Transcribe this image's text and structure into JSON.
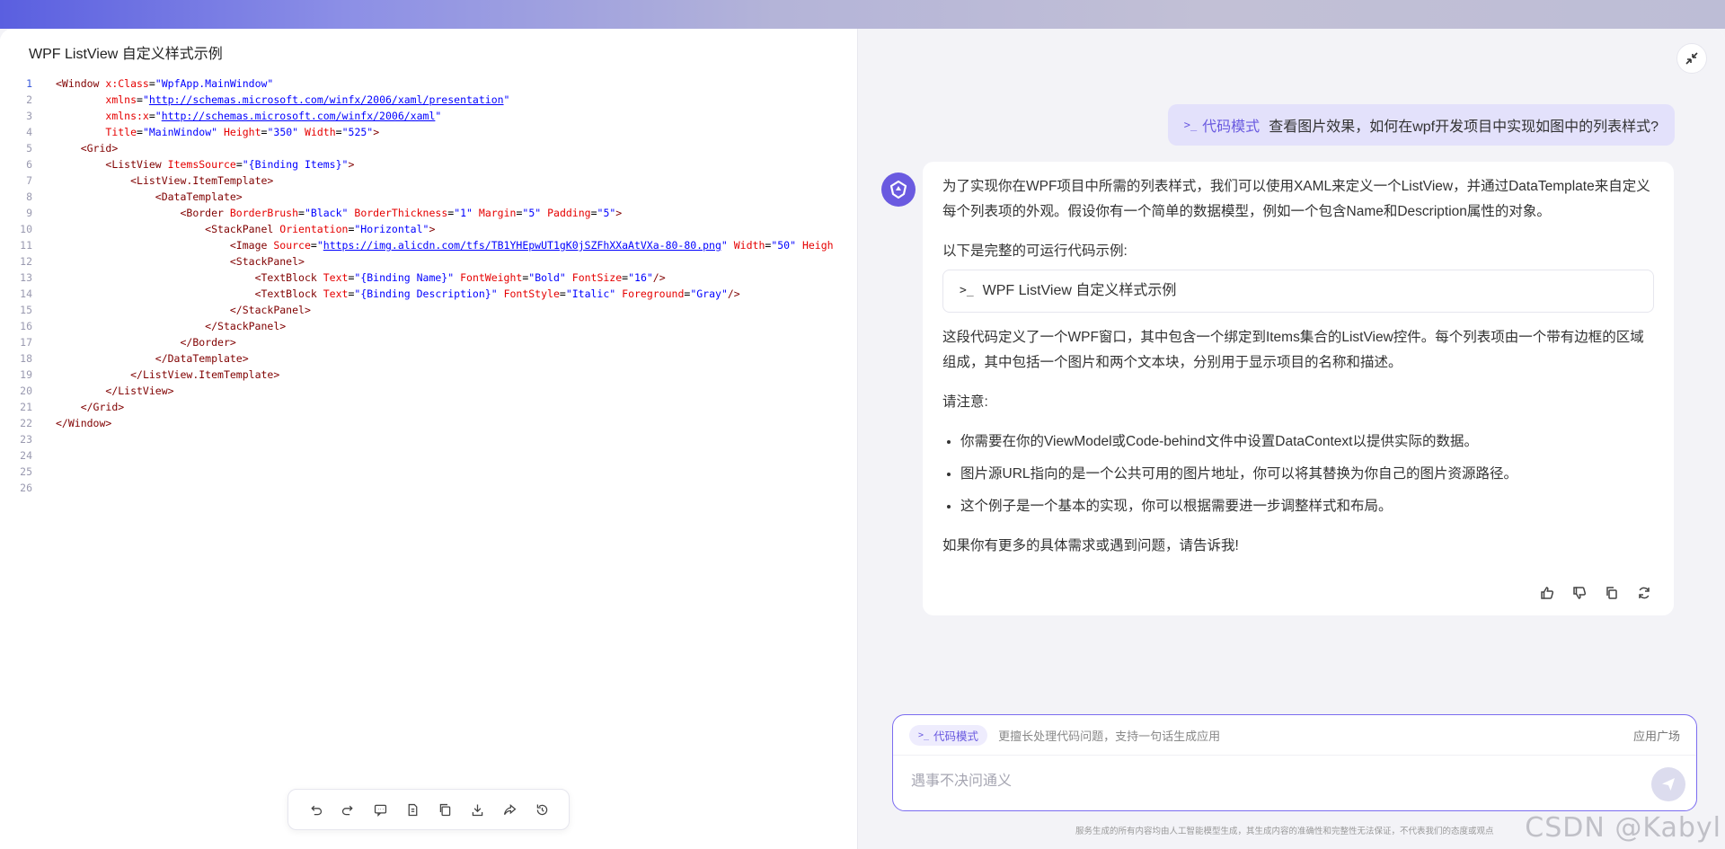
{
  "left": {
    "title": "WPF ListView 自定义样式示例",
    "line_numbers": [
      "1",
      "2",
      "3",
      "4",
      "5",
      "6",
      "7",
      "8",
      "9",
      "10",
      "11",
      "12",
      "13",
      "14",
      "15",
      "16",
      "17",
      "18",
      "19",
      "20",
      "21",
      "22",
      "23",
      "24",
      "25",
      "26"
    ],
    "code_lines": [
      [
        [
          "tag",
          "<Window "
        ],
        [
          "attr",
          "x:Class"
        ],
        [
          "plain",
          "="
        ],
        [
          "val",
          "\"WpfApp.MainWindow\""
        ]
      ],
      [
        [
          "plain",
          "        "
        ],
        [
          "attr",
          "xmlns"
        ],
        [
          "plain",
          "="
        ],
        [
          "val",
          "\""
        ],
        [
          "url",
          "http://schemas.microsoft.com/winfx/2006/xaml/presentation"
        ],
        [
          "val",
          "\""
        ]
      ],
      [
        [
          "plain",
          "        "
        ],
        [
          "attr",
          "xmlns:x"
        ],
        [
          "plain",
          "="
        ],
        [
          "val",
          "\""
        ],
        [
          "url",
          "http://schemas.microsoft.com/winfx/2006/xaml"
        ],
        [
          "val",
          "\""
        ]
      ],
      [
        [
          "plain",
          "        "
        ],
        [
          "attr",
          "Title"
        ],
        [
          "plain",
          "="
        ],
        [
          "val",
          "\"MainWindow\""
        ],
        [
          "plain",
          " "
        ],
        [
          "attr",
          "Height"
        ],
        [
          "plain",
          "="
        ],
        [
          "val",
          "\"350\""
        ],
        [
          "plain",
          " "
        ],
        [
          "attr",
          "Width"
        ],
        [
          "plain",
          "="
        ],
        [
          "val",
          "\"525\""
        ],
        [
          "tag",
          ">"
        ]
      ],
      [
        [
          "plain",
          "    "
        ],
        [
          "tag",
          "<Grid>"
        ]
      ],
      [
        [
          "plain",
          "        "
        ],
        [
          "tag",
          "<ListView "
        ],
        [
          "attr",
          "ItemsSource"
        ],
        [
          "plain",
          "="
        ],
        [
          "val",
          "\"{Binding Items}\""
        ],
        [
          "tag",
          ">"
        ]
      ],
      [
        [
          "plain",
          "            "
        ],
        [
          "tag",
          "<ListView.ItemTemplate>"
        ]
      ],
      [
        [
          "plain",
          "                "
        ],
        [
          "tag",
          "<DataTemplate>"
        ]
      ],
      [
        [
          "plain",
          "                    "
        ],
        [
          "tag",
          "<Border "
        ],
        [
          "attr",
          "BorderBrush"
        ],
        [
          "plain",
          "="
        ],
        [
          "val",
          "\"Black\""
        ],
        [
          "plain",
          " "
        ],
        [
          "attr",
          "BorderThickness"
        ],
        [
          "plain",
          "="
        ],
        [
          "val",
          "\"1\""
        ],
        [
          "plain",
          " "
        ],
        [
          "attr",
          "Margin"
        ],
        [
          "plain",
          "="
        ],
        [
          "val",
          "\"5\""
        ],
        [
          "plain",
          " "
        ],
        [
          "attr",
          "Padding"
        ],
        [
          "plain",
          "="
        ],
        [
          "val",
          "\"5\""
        ],
        [
          "tag",
          ">"
        ]
      ],
      [
        [
          "plain",
          "                        "
        ],
        [
          "tag",
          "<StackPanel "
        ],
        [
          "attr",
          "Orientation"
        ],
        [
          "plain",
          "="
        ],
        [
          "val",
          "\"Horizontal\""
        ],
        [
          "tag",
          ">"
        ]
      ],
      [
        [
          "plain",
          "                            "
        ],
        [
          "tag",
          "<Image "
        ],
        [
          "attr",
          "Source"
        ],
        [
          "plain",
          "="
        ],
        [
          "val",
          "\""
        ],
        [
          "url",
          "https://img.alicdn.com/tfs/TB1YHEpwUT1gK0jSZFhXXaAtVXa-80-80.png"
        ],
        [
          "val",
          "\""
        ],
        [
          "plain",
          " "
        ],
        [
          "attr",
          "Width"
        ],
        [
          "plain",
          "="
        ],
        [
          "val",
          "\"50\""
        ],
        [
          "plain",
          " "
        ],
        [
          "attr",
          "Heigh"
        ]
      ],
      [
        [
          "plain",
          "                            "
        ],
        [
          "tag",
          "<StackPanel>"
        ]
      ],
      [
        [
          "plain",
          "                                "
        ],
        [
          "tag",
          "<TextBlock "
        ],
        [
          "attr",
          "Text"
        ],
        [
          "plain",
          "="
        ],
        [
          "val",
          "\"{Binding Name}\""
        ],
        [
          "plain",
          " "
        ],
        [
          "attr",
          "FontWeight"
        ],
        [
          "plain",
          "="
        ],
        [
          "val",
          "\"Bold\""
        ],
        [
          "plain",
          " "
        ],
        [
          "attr",
          "FontSize"
        ],
        [
          "plain",
          "="
        ],
        [
          "val",
          "\"16\""
        ],
        [
          "tag",
          "/>"
        ]
      ],
      [
        [
          "plain",
          "                                "
        ],
        [
          "tag",
          "<TextBlock "
        ],
        [
          "attr",
          "Text"
        ],
        [
          "plain",
          "="
        ],
        [
          "val",
          "\"{Binding Description}\""
        ],
        [
          "plain",
          " "
        ],
        [
          "attr",
          "FontStyle"
        ],
        [
          "plain",
          "="
        ],
        [
          "val",
          "\"Italic\""
        ],
        [
          "plain",
          " "
        ],
        [
          "attr",
          "Foreground"
        ],
        [
          "plain",
          "="
        ],
        [
          "val",
          "\"Gray\""
        ],
        [
          "tag",
          "/>"
        ]
      ],
      [
        [
          "plain",
          "                            "
        ],
        [
          "tag",
          "</StackPanel>"
        ]
      ],
      [
        [
          "plain",
          "                        "
        ],
        [
          "tag",
          "</StackPanel>"
        ]
      ],
      [
        [
          "plain",
          "                    "
        ],
        [
          "tag",
          "</Border>"
        ]
      ],
      [
        [
          "plain",
          "                "
        ],
        [
          "tag",
          "</DataTemplate>"
        ]
      ],
      [
        [
          "plain",
          "            "
        ],
        [
          "tag",
          "</ListView.ItemTemplate>"
        ]
      ],
      [
        [
          "plain",
          "        "
        ],
        [
          "tag",
          "</ListView>"
        ]
      ],
      [
        [
          "plain",
          "    "
        ],
        [
          "tag",
          "</Grid>"
        ]
      ],
      [
        [
          "tag",
          "</Window>"
        ]
      ],
      [],
      [],
      [],
      []
    ],
    "toolbar": [
      "undo-icon",
      "redo-icon",
      "comment-icon",
      "document-icon",
      "copy-icon",
      "download-icon",
      "share-icon",
      "history-icon"
    ]
  },
  "chat": {
    "user_message": {
      "mode_prompt": ">_",
      "mode_label": "代码模式",
      "text": "查看图片效果，如何在wpf开发项目中实现如图中的列表样式?"
    },
    "answer": {
      "p1": "为了实现你在WPF项目中所需的列表样式，我们可以使用XAML来定义一个ListView，并通过DataTemplate来自定义每个列表项的外观。假设你有一个简单的数据模型，例如一个包含Name和Description属性的对象。",
      "p2": "以下是完整的可运行代码示例:",
      "code_card_prompt": ">_",
      "code_card_title": "WPF ListView 自定义样式示例",
      "p3": "这段代码定义了一个WPF窗口，其中包含一个绑定到Items集合的ListView控件。每个列表项由一个带有边框的区域组成，其中包括一个图片和两个文本块，分别用于显示项目的名称和描述。",
      "p4": "请注意:",
      "bullets": [
        "你需要在你的ViewModel或Code-behind文件中设置DataContext以提供实际的数据。",
        "图片源URL指向的是一个公共可用的图片地址，你可以将其替换为你自己的图片资源路径。",
        "这个例子是一个基本的实现，你可以根据需要进一步调整样式和布局。"
      ],
      "p5": "如果你有更多的具体需求或遇到问题，请告诉我!"
    },
    "composer": {
      "chip_prompt": ">_",
      "chip_label": "代码模式",
      "hint": "更擅长处理代码问题，支持一句话生成应用",
      "app_plaza": "应用广场",
      "placeholder": "遇事不决问通义"
    },
    "disclaimer": "服务生成的所有内容均由人工智能模型生成，其生成内容的准确性和完整性无法保证，不代表我们的态度或观点",
    "watermark": "CSDN @Kabyl"
  },
  "colors": {
    "accent": "#6a5ae0",
    "user_bubble": "#e3e1fb",
    "xml_tag": "#800000",
    "xml_attr": "#e50000",
    "xml_value": "#0000ff"
  }
}
